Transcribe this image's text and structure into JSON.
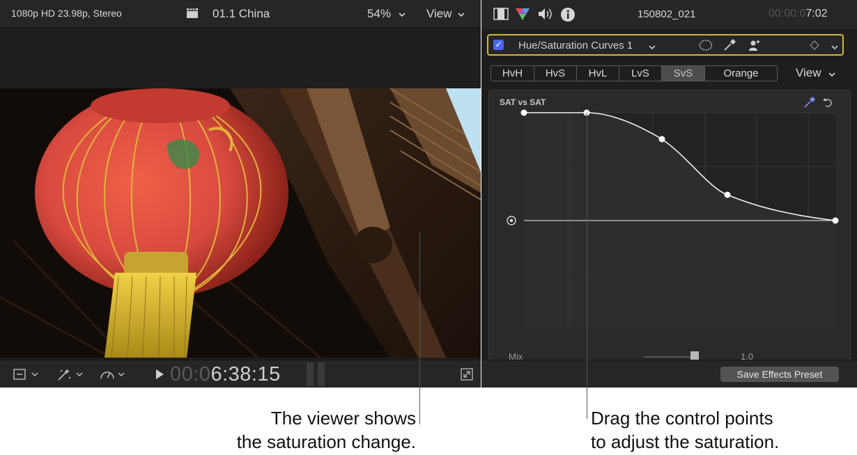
{
  "viewer": {
    "format": "1080p HD 23.98p, Stereo",
    "clip_name": "01.1 China",
    "zoom": "54%",
    "view_label": "View",
    "timecode_dim": "00:0",
    "timecode_bright": "6:38:15"
  },
  "inspector": {
    "clip_name": "150802_021",
    "timecode_dim": "00:00:0",
    "timecode_bright": "7:02",
    "effect_name": "Hue/Saturation Curves 1",
    "curve_tabs": [
      {
        "label": "HvH",
        "active": false
      },
      {
        "label": "HvS",
        "active": false
      },
      {
        "label": "HvL",
        "active": false
      },
      {
        "label": "LvS",
        "active": false
      },
      {
        "label": "SvS",
        "active": true
      },
      {
        "label": "Orange",
        "active": false
      }
    ],
    "view_label": "View",
    "graph_title": "SAT vs SAT",
    "mix_label": "Mix",
    "mix_value": "1.0",
    "save_preset_label": "Save Effects Preset"
  },
  "callouts": {
    "left_line1": "The viewer shows",
    "left_line2": "the saturation change.",
    "right_line1": "Drag the control points",
    "right_line2": "to adjust the saturation."
  },
  "icons": [
    "clapper-icon",
    "film-icon",
    "color-icon",
    "audio-icon",
    "info-icon",
    "transform-icon",
    "magic-icon",
    "speed-icon",
    "play-icon",
    "fullscreen-icon",
    "mask-icon",
    "eyedropper-icon",
    "person-icon",
    "keyframe-icon",
    "reset-icon"
  ],
  "colors": {
    "accent_blue": "#4b67f2",
    "selection_gold": "#d7b53a",
    "lantern_red": "#d94a3f"
  }
}
